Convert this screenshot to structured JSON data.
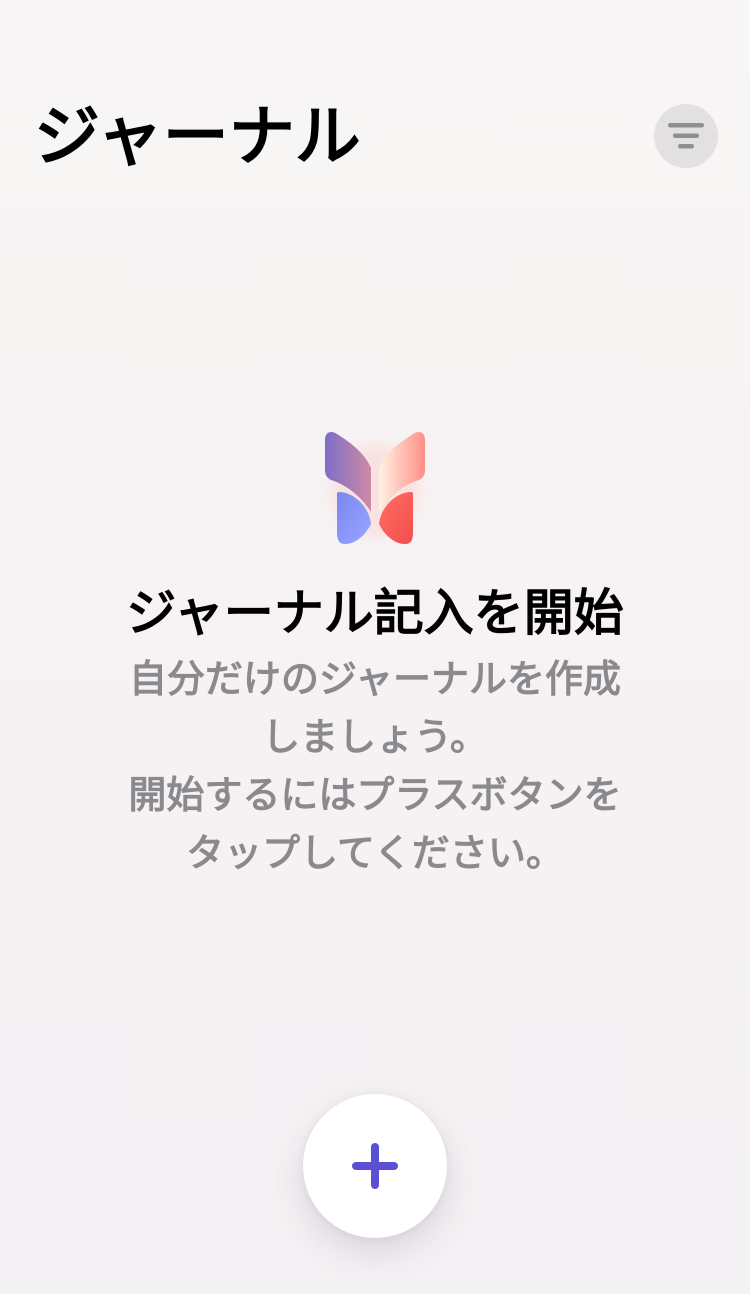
{
  "header": {
    "title": "ジャーナル",
    "filter_icon": "filter-lines-icon"
  },
  "empty_state": {
    "logo_icon": "journal-butterfly-logo",
    "title": "ジャーナル記入を開始",
    "description_lines": [
      "自分だけのジャーナルを作成",
      "しましょう。",
      "開始するにはプラスボタンを",
      "タップしてください。"
    ]
  },
  "add_button": {
    "icon": "plus-icon"
  },
  "colors": {
    "background": "#f7f3f4",
    "title": "#000000",
    "description": "#8a8a8e",
    "filter_button_bg": "#e3e0e1",
    "filter_lines": "#8e8e93",
    "accent": "#5b4fd3",
    "butterfly_left": "#8d7bd6",
    "butterfly_right": "#ff7a6e"
  }
}
